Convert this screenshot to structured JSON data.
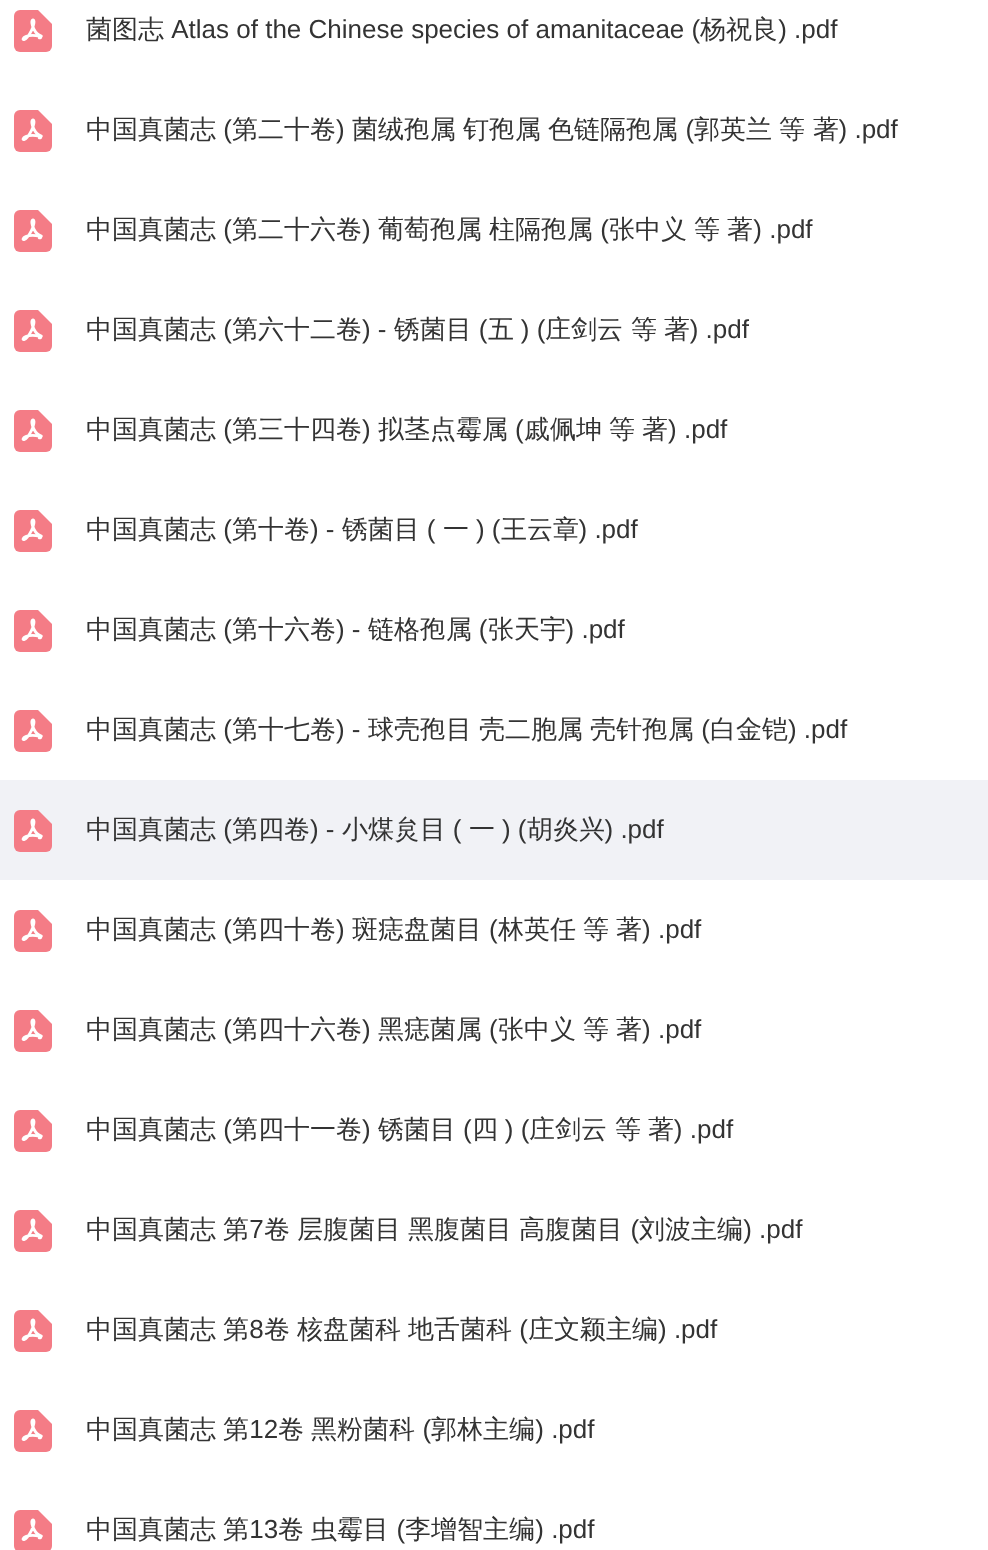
{
  "files": [
    {
      "name": "菌图志 Atlas of the Chinese species of amanitaceae (杨祝良) .pdf",
      "selected": false
    },
    {
      "name": "中国真菌志 (第二十卷) 菌绒孢属 钉孢属 色链隔孢属 (郭英兰 等 著) .pdf",
      "selected": false
    },
    {
      "name": "中国真菌志 (第二十六卷) 葡萄孢属 柱隔孢属 (张中义 等 著) .pdf",
      "selected": false
    },
    {
      "name": "中国真菌志 (第六十二卷) - 锈菌目 (五 ) (庄剑云 等 著) .pdf",
      "selected": false
    },
    {
      "name": "中国真菌志 (第三十四卷) 拟茎点霉属 (戚佩坤 等 著) .pdf",
      "selected": false
    },
    {
      "name": "中国真菌志 (第十卷) - 锈菌目 ( 一 ) (王云章) .pdf",
      "selected": false
    },
    {
      "name": "中国真菌志 (第十六卷) - 链格孢属 (张天宇) .pdf",
      "selected": false
    },
    {
      "name": "中国真菌志 (第十七卷) - 球壳孢目 壳二胞属 壳针孢属 (白金铠) .pdf",
      "selected": false
    },
    {
      "name": "中国真菌志 (第四卷) - 小煤炱目 ( 一 ) (胡炎兴) .pdf",
      "selected": true
    },
    {
      "name": "中国真菌志 (第四十卷) 斑痣盘菌目 (林英任 等 著) .pdf",
      "selected": false
    },
    {
      "name": "中国真菌志 (第四十六卷) 黑痣菌属 (张中义 等 著) .pdf",
      "selected": false
    },
    {
      "name": "中国真菌志 (第四十一卷) 锈菌目 (四 ) (庄剑云 等 著) .pdf",
      "selected": false
    },
    {
      "name": "中国真菌志 第7卷 层腹菌目 黑腹菌目 高腹菌目 (刘波主编) .pdf",
      "selected": false
    },
    {
      "name": "中国真菌志 第8卷 核盘菌科 地舌菌科 (庄文颖主编) .pdf",
      "selected": false
    },
    {
      "name": "中国真菌志 第12卷 黑粉菌科 (郭林主编) .pdf",
      "selected": false
    },
    {
      "name": "中国真菌志 第13卷 虫霉目 (李增智主编) .pdf",
      "selected": false
    }
  ]
}
